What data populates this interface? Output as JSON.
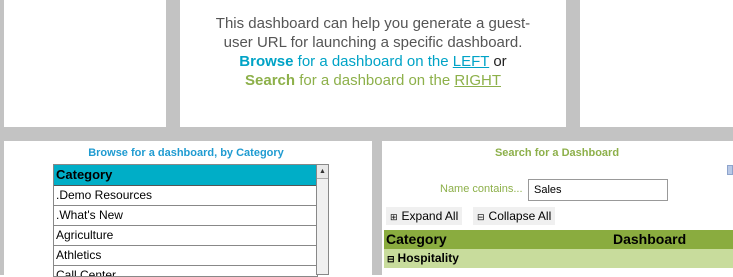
{
  "header": {
    "line1": "This dashboard can help you generate a guest-",
    "line2": "user URL for launching a specific dashboard.",
    "browse_word": "Browse",
    "browse_rest": " for a dashboard on the ",
    "browse_link": "LEFT",
    "or_word": " or",
    "search_word": "Search",
    "search_rest": " for a dashboard on the ",
    "search_link": "RIGHT"
  },
  "left_panel": {
    "title": "Browse for a dashboard, by Category",
    "column_header": "Category",
    "items": [
      ".Demo Resources",
      ".What's New",
      "Agriculture",
      "Athletics",
      "Call Center"
    ]
  },
  "right_panel": {
    "title": "Search for a Dashboard",
    "name_label": "Name contains...",
    "name_value": "Sales",
    "expand_all": "Expand All",
    "collapse_all": "Collapse All",
    "columns": [
      "Category",
      "Dashboard"
    ],
    "group": "Hospitality"
  },
  "colors": {
    "browse_accent": "#00a3c6",
    "search_accent": "#8db04a",
    "category_header_bg": "#00aec7",
    "results_header_bg": "#8aac3f",
    "group_row_bg": "#c8dc9c",
    "frame_gray": "#c3c3c3"
  },
  "icons": {
    "expand": "plus-box-icon",
    "collapse": "minus-box-icon",
    "scroll_up": "chevron-up-icon"
  }
}
